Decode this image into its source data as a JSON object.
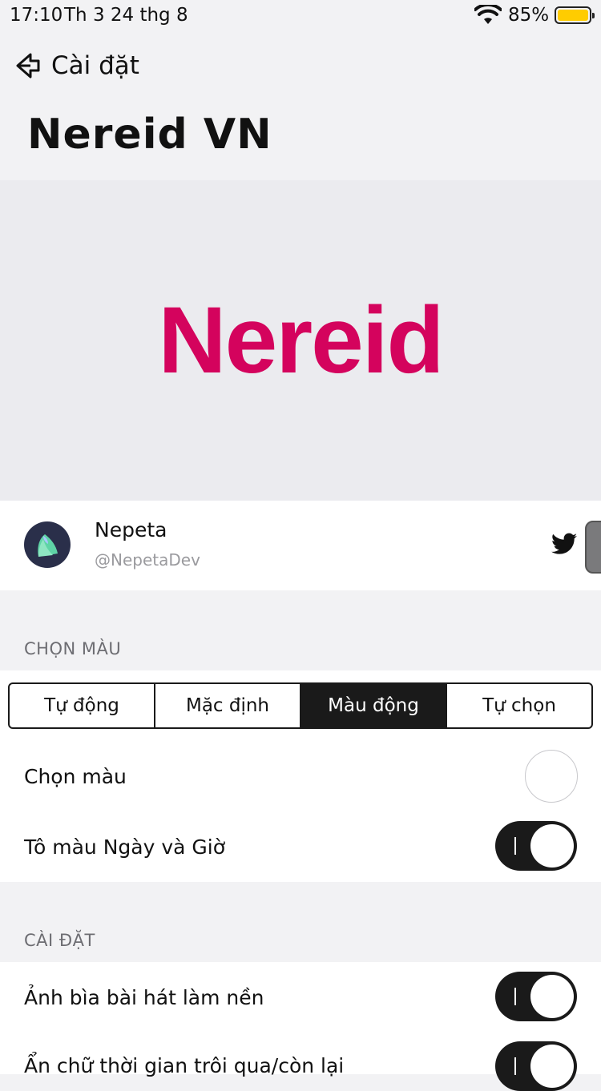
{
  "status_bar": {
    "time": "17:10",
    "date": "Th 3 24 thg 8",
    "battery_percent": "85%",
    "battery_level": 0.85,
    "battery_color": "#ffcc00"
  },
  "nav": {
    "back_label": "Cài đặt"
  },
  "page_title": "Nereid VN",
  "banner": {
    "logo_text": "Nereid",
    "logo_color": "#d4035d"
  },
  "developer": {
    "name": "Nepeta",
    "handle": "@NepetaDev",
    "link_icon": "twitter-icon"
  },
  "sections": {
    "color": {
      "header": "CHỌN MÀU",
      "segments": [
        "Tự động",
        "Mặc định",
        "Màu động",
        "Tự chọn"
      ],
      "selected_segment": "Màu động",
      "pick_color_label": "Chọn màu",
      "tint_date_time_label": "Tô màu Ngày và Giờ",
      "tint_date_time_on": true
    },
    "settings": {
      "header": "CÀI ĐẶT",
      "artwork_bg_label": "Ảnh bìa bài hát làm nền",
      "artwork_bg_on": true,
      "hide_time_label": "Ẩn chữ thời gian trôi qua/còn lại",
      "hide_time_on": true
    }
  },
  "colors": {
    "accent_dark": "#1a1a1a",
    "background": "#f2f2f4"
  }
}
